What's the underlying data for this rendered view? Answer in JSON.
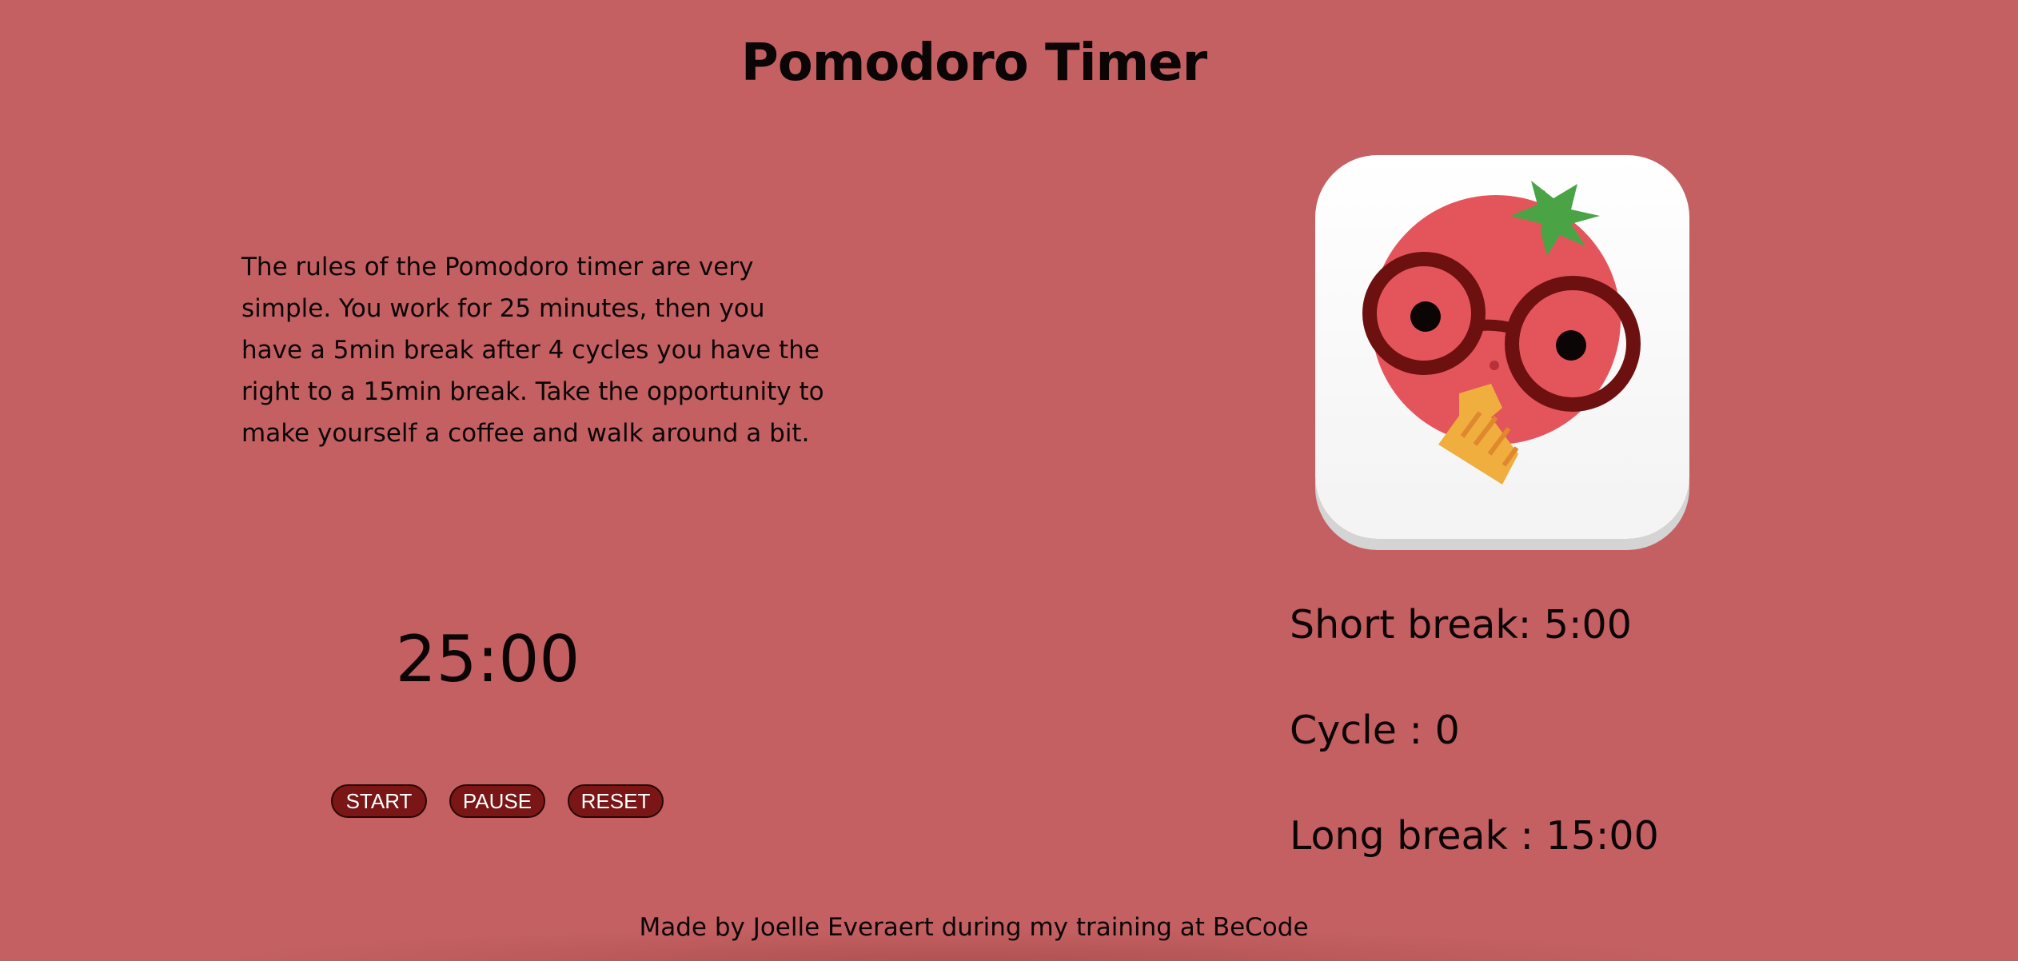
{
  "header": {
    "title": "Pomodoro Timer"
  },
  "rules": {
    "text": "The rules of the Pomodoro timer are very simple. You work for 25 minutes, then you have a 5min break after 4 cycles you have the right to a 15min break. Take the opportunity to make yourself a coffee and walk around a bit."
  },
  "logo": {
    "icon": "tomato-with-glasses-icon"
  },
  "timer": {
    "display": "25:00"
  },
  "controls": {
    "start_label": "START",
    "pause_label": "PAUSE",
    "reset_label": "RESET"
  },
  "stats": {
    "short_break": "Short break: 5:00",
    "cycle": "Cycle : 0",
    "long_break": "Long break : 15:00"
  },
  "footer": {
    "text": "Made by Joelle Everaert during my training at BeCode"
  },
  "colors": {
    "background": "#c46062",
    "button": "#7a1616",
    "button_text": "#ffffff",
    "text": "#0c0506"
  }
}
